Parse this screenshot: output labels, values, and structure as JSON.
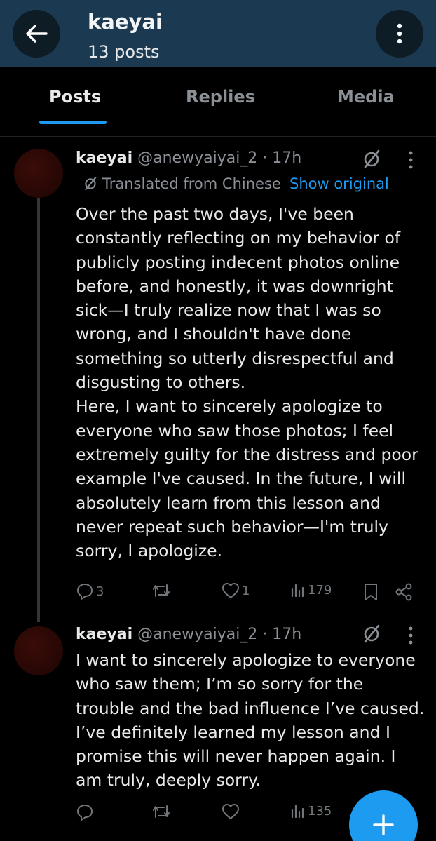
{
  "header": {
    "title": "kaeyai",
    "subtitle": "13 posts"
  },
  "tabs": [
    {
      "label": "Posts",
      "active": true
    },
    {
      "label": "Replies",
      "active": false
    },
    {
      "label": "Media",
      "active": false
    }
  ],
  "posts": [
    {
      "name": "kaeyai",
      "handle_time": "@anewyaiyai_2 · 17h",
      "translated_label": "Translated from Chinese",
      "show_original": "Show original",
      "text": "Over the past two days, I've been constantly reflecting on my behavior of publicly posting indecent photos online before, and honestly, it was downright sick—I truly realize now that I was so wrong, and I shouldn't have done something so utterly disrespectful and disgusting to others.\nHere, I want to sincerely apologize to everyone who saw those photos; I feel extremely guilty for the distress and poor example I've caused. In the future, I will absolutely learn from this lesson and never repeat such behavior—I'm truly sorry, I apologize.",
      "replies": "3",
      "reposts": "",
      "likes": "1",
      "views": "179"
    },
    {
      "name": "kaeyai",
      "handle_time": "@anewyaiyai_2 · 17h",
      "text": "I want to sincerely apologize to everyone who saw them; I’m so sorry for the trouble and the bad influence I’ve caused. I’ve definitely learned my lesson and I promise this will never happen again. I am truly, deeply sorry.",
      "replies": "",
      "reposts": "",
      "likes": "",
      "views": "135"
    }
  ],
  "colors": {
    "header_bg": "#1b3a52",
    "accent": "#1d9bf0",
    "text": "#e7e9ea",
    "muted": "#8b9096"
  },
  "icons": {
    "back": "arrow-left-icon",
    "more": "more-vertical-icon",
    "grok": "grok-icon",
    "reply": "reply-icon",
    "repost": "repost-icon",
    "like": "heart-icon",
    "views": "views-icon",
    "bookmark": "bookmark-icon",
    "share": "share-icon",
    "compose": "plus-icon"
  }
}
